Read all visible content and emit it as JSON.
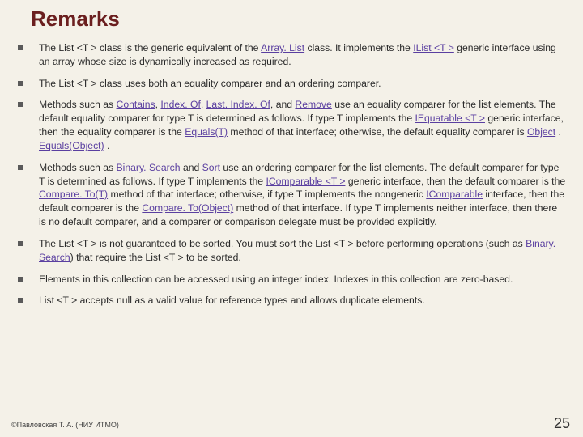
{
  "title": "Remarks",
  "bullets": [
    {
      "pre": "The List <T > class is the generic equivalent of the ",
      "link1": "Array. List",
      "mid1": " class. It implements the ",
      "link2": "IList <T >",
      "post": " generic interface using an array whose size is dynamically increased as required."
    },
    {
      "text": "The List <T > class uses both an equality comparer and an ordering comparer."
    },
    {
      "pre": "Methods such as ",
      "l1": "Contains",
      "s1": ", ",
      "l2": "Index. Of",
      "s2": ", ",
      "l3": "Last. Index. Of",
      "s3": ", and ",
      "l4": "Remove",
      "mid1": " use an equality comparer for the list elements. The default equality comparer for type T is determined as follows. If type T implements the ",
      "l5": "IEquatable <T >",
      "mid2": " generic interface, then the equality comparer is the ",
      "l6": "Equals(T)",
      "mid3": " method of that interface; otherwise, the default equality comparer is ",
      "l7": "Object",
      "s4": " . ",
      "l8": "Equals(Object)",
      "post": " ."
    },
    {
      "pre": "Methods such as ",
      "l1": "Binary. Search",
      "s1": " and ",
      "l2": "Sort",
      "mid1": " use an ordering comparer for the list elements. The default comparer for type T is determined as follows. If type T implements the ",
      "l3": "IComparable <T >",
      "mid2": " generic interface, then the default comparer is the ",
      "l4": "Compare. To(T)",
      "mid3": " method of that interface; otherwise, if type T implements the nongeneric ",
      "l5": "IComparable",
      "mid4": " interface, then the default comparer is the ",
      "l6": "Compare. To(Object)",
      "post": " method of that interface. If type T implements neither interface, then there is no default comparer, and a comparer or comparison delegate must be provided explicitly."
    },
    {
      "pre": "The List <T > is not guaranteed to be sorted. You must sort the List <T > before performing operations (such as ",
      "l1": "Binary. Search",
      "post": ") that require the List <T > to be sorted."
    },
    {
      "text": "Elements in this collection can be accessed using an integer index. Indexes in this collection are zero-based."
    },
    {
      "text": "List <T > accepts null as a valid value for reference types and allows duplicate elements."
    }
  ],
  "footer": "©Павловская Т. А. (НИУ ИТМО)",
  "pagenum": "25"
}
